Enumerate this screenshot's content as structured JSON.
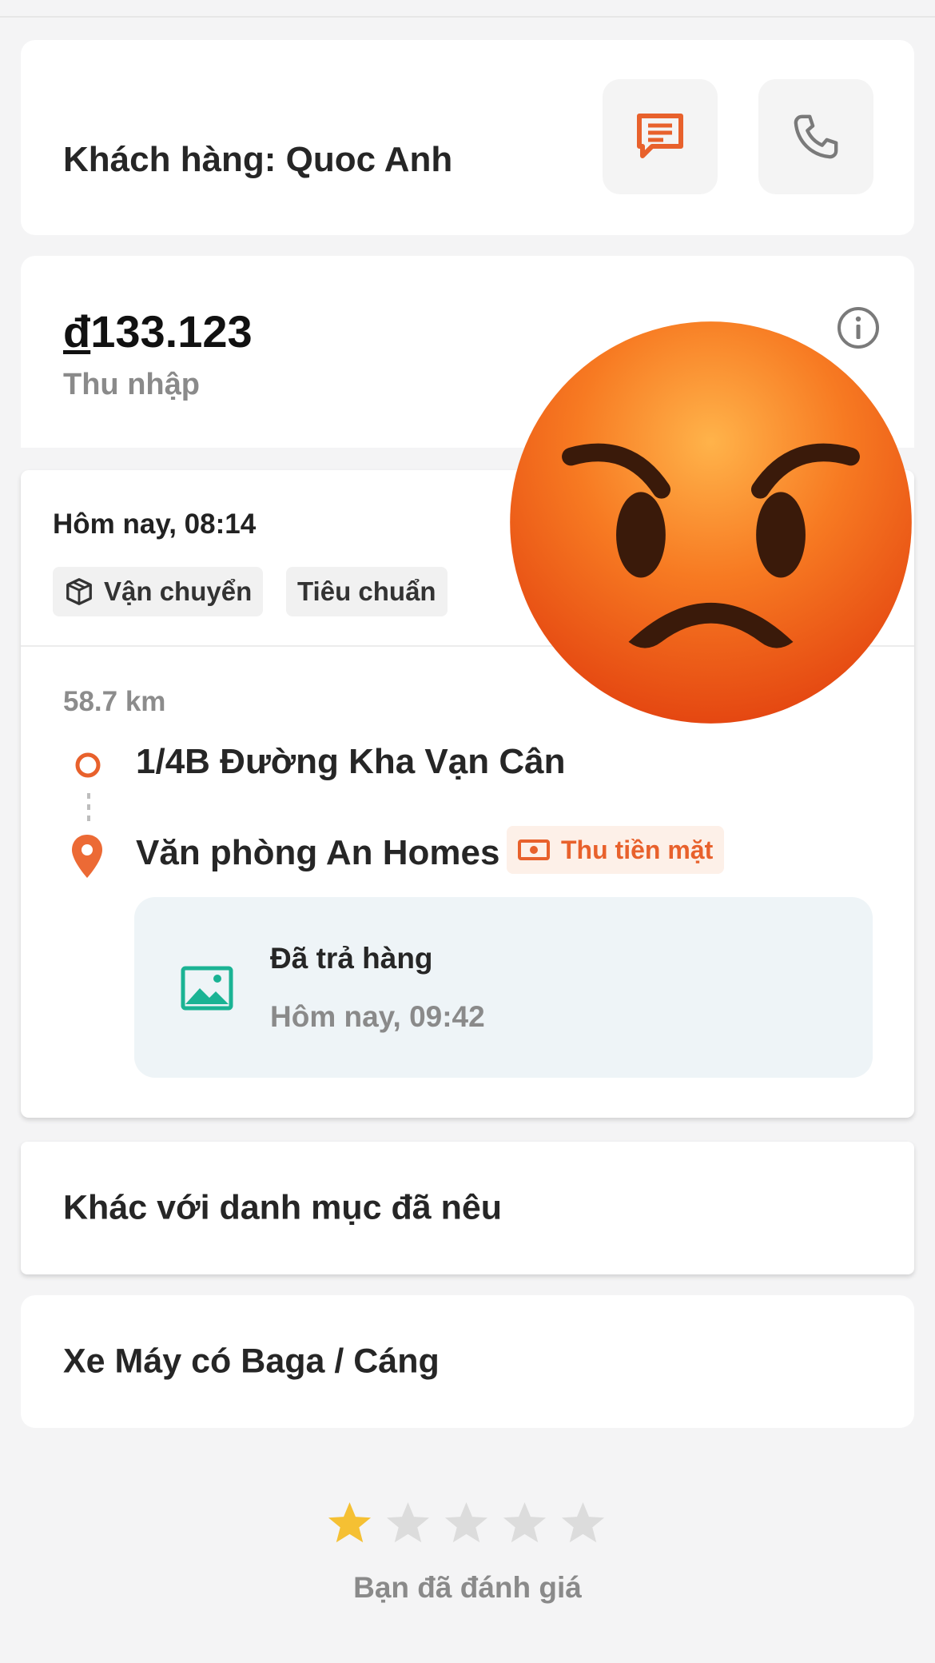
{
  "customer": {
    "title": "Khách hàng: Quoc Anh",
    "chat_icon": "chat-icon",
    "call_icon": "phone-icon"
  },
  "income": {
    "currency_symbol": "đ",
    "amount": "133.123",
    "label": "Thu nhập",
    "info_icon": "info-icon"
  },
  "trip": {
    "time": "Hôm nay, 08:14",
    "tags": [
      "Vận chuyển",
      "Tiêu chuẩn"
    ],
    "distance": "58.7 km",
    "pickup_address": "1/4B Đường Kha Vạn Cân",
    "dropoff_address": "Văn phòng An Homes",
    "payment_badge": "Thu tiền mặt",
    "status": {
      "title": "Đã trả hàng",
      "time": "Hôm nay, 09:42",
      "icon": "image-icon"
    }
  },
  "other_category": "Khác với danh mục đã nêu",
  "vehicle_type": "Xe Máy có Baga / Cáng",
  "rating": {
    "value": 1,
    "max": 5,
    "label": "Bạn đã đánh giá"
  },
  "colors": {
    "accent": "#e8612c",
    "star_filled": "#f5c033",
    "star_empty": "#dcdcdc",
    "status_icon": "#1ab394"
  },
  "overlay": "angry-face-emoji"
}
